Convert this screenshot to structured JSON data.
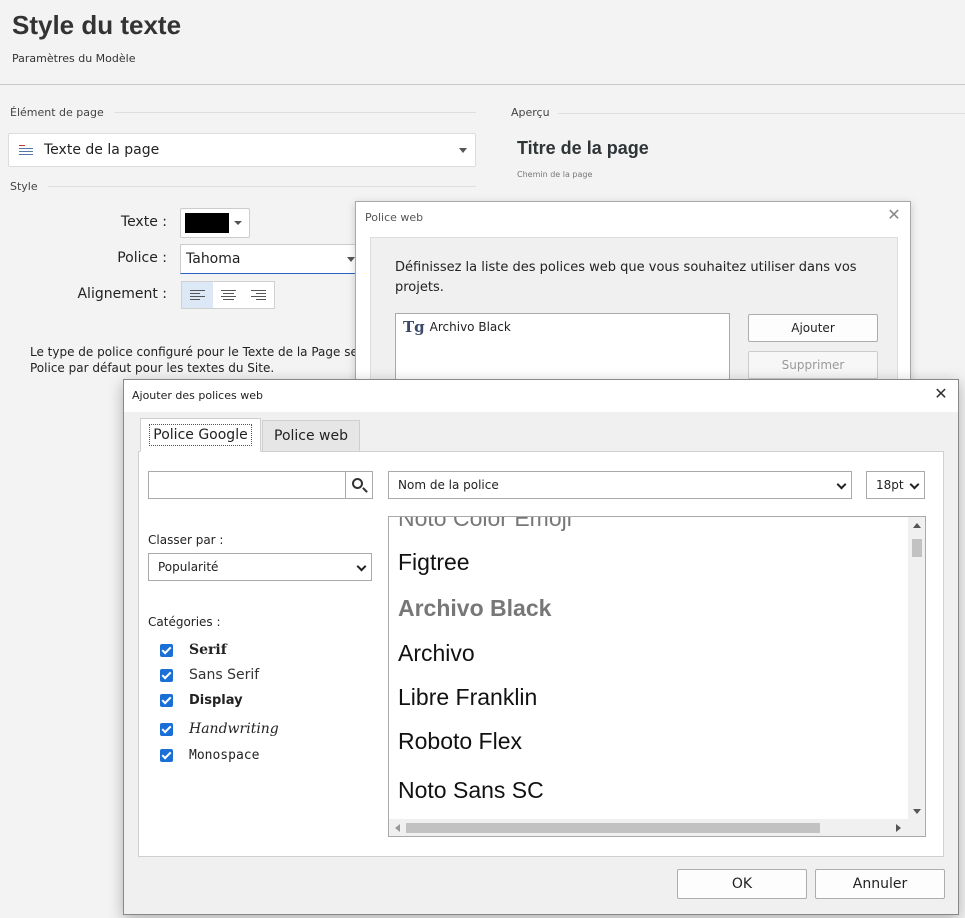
{
  "page": {
    "title": "Style du texte",
    "subtitle": "Paramètres du Modèle"
  },
  "page_element": {
    "group_label": "Élément de page",
    "selected": "Texte de la page"
  },
  "style": {
    "group_label": "Style",
    "text_label": "Texte :",
    "text_color": "#000000",
    "font_label": "Police :",
    "font_value": "Tahoma",
    "align_label": "Alignement :"
  },
  "info": {
    "line1": "Le type de police configuré pour le Texte de la Page ser",
    "line2": "Police par défaut pour les textes du Site."
  },
  "preview": {
    "label": "Aperçu",
    "title": "Titre de la page",
    "path": "Chemin de la page"
  },
  "police_web_dialog": {
    "title": "Police web",
    "close": "✕",
    "description": "Définissez la liste des polices web que vous souhaitez utiliser dans vos projets.",
    "fonts": [
      "Archivo Black"
    ],
    "add_label": "Ajouter",
    "remove_label": "Supprimer"
  },
  "add_fonts_dialog": {
    "title": "Ajouter des polices web",
    "close": "✕",
    "tabs": [
      {
        "label": "Police Google"
      },
      {
        "label": "Police web"
      }
    ],
    "search": {
      "value": "",
      "placeholder": ""
    },
    "name_select": "Nom de la police",
    "size_select": "18pt",
    "sort_label": "Classer par :",
    "sort_value": "Popularité",
    "categories_label": "Catégories :",
    "categories": [
      {
        "label": "Serif",
        "checked": true
      },
      {
        "label": "Sans Serif",
        "checked": true
      },
      {
        "label": "Display",
        "checked": true
      },
      {
        "label": "Handwriting",
        "checked": true
      },
      {
        "label": "Monospace",
        "checked": true
      }
    ],
    "font_list": [
      "Noto Color Emoji",
      "Figtree",
      "Archivo Black",
      "Archivo",
      "Libre Franklin",
      "Roboto Flex",
      "Noto Sans SC"
    ],
    "ok_label": "OK",
    "cancel_label": "Annuler"
  }
}
